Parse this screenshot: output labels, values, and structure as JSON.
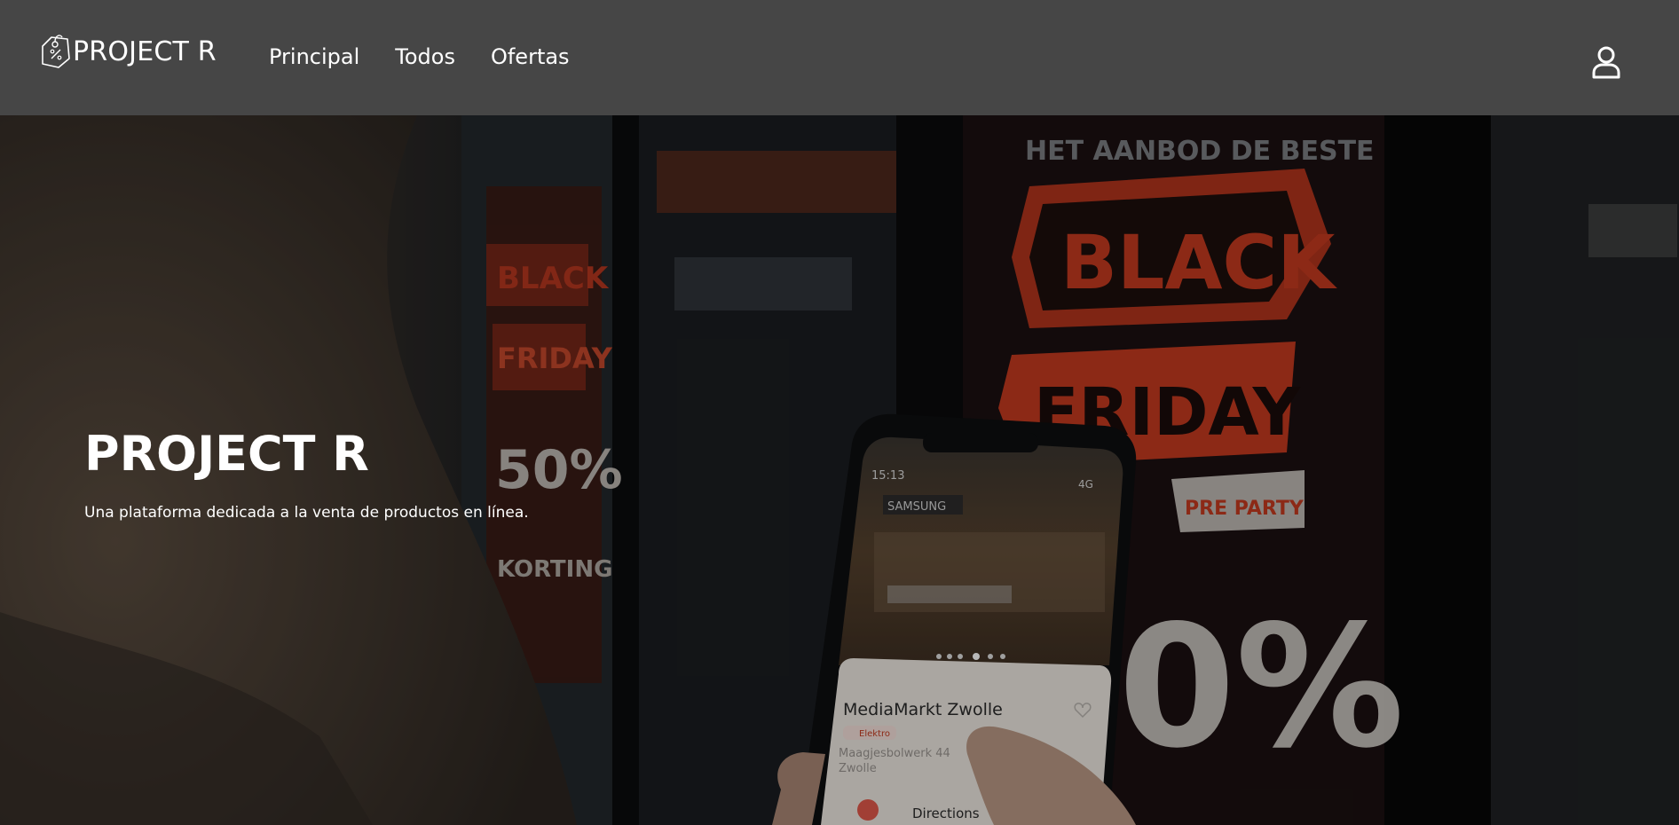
{
  "navbar": {
    "brand": "PROJECT R",
    "links": [
      "Principal",
      "Todos",
      "Ofertas"
    ]
  },
  "hero": {
    "title": "PROJECT R",
    "subtitle": "Una plataforma dedicada a la venta de productos en línea."
  },
  "photo": {
    "sign_main_top": "BLACK",
    "sign_main_bottom": "FRIDAY",
    "sign_top_banner": "HET AANBOD DE BESTE",
    "sign_percent": "0%",
    "sign_left_top": "BLACK",
    "sign_left_mid": "FRIDAY",
    "sign_left_percent": "50%",
    "sign_left_bottom": "KORTING",
    "sign_small_badge": "PRE PARTY",
    "phone_time": "15:13",
    "phone_signal": "4G",
    "phone_store_sign": "SAMSUNG",
    "phone_card_title": "MediaMarkt Zwolle",
    "phone_card_tag": "Elektro",
    "phone_card_address_1": "Maagjesbolwerk 44",
    "phone_card_address_2": "Zwolle",
    "phone_card_directions": "Directions"
  },
  "colors": {
    "navbar_bg": "#464646",
    "sign_red": "#c2391f",
    "nav_text": "#ffffff"
  },
  "icons": {
    "brand": "shopping-tag-icon",
    "user": "user-icon"
  }
}
